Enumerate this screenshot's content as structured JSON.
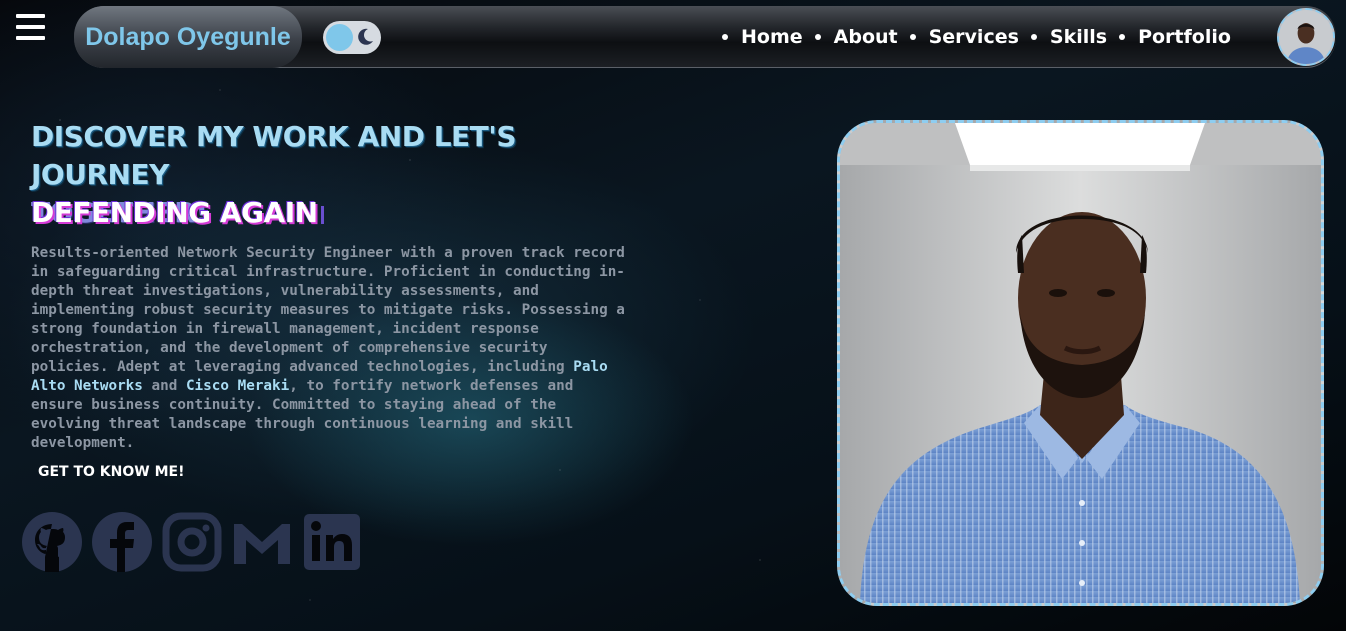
{
  "header": {
    "brand": "Dolapo Oyegunle",
    "nav": [
      {
        "label": "Home"
      },
      {
        "label": "About"
      },
      {
        "label": "Services"
      },
      {
        "label": "Skills"
      },
      {
        "label": "Portfolio"
      }
    ],
    "icons": {
      "menu": "hamburger-menu-icon",
      "theme": "moon-icon",
      "avatar": "profile-avatar"
    }
  },
  "hero": {
    "headline_line1": "Discover My Work and Let's Journey",
    "headline_line2": "Together!",
    "typed_text": "Defending Again",
    "bio": {
      "part1": "Results-oriented Network Security Engineer with a proven track record in safeguarding critical infrastructure. Proficient in conducting in-depth threat investigations, vulnerability assessments, and implementing robust security measures to mitigate risks. Possessing a strong foundation in firewall management, incident response orchestration, and the development of comprehensive security policies. Adept at leveraging advanced technologies, including ",
      "highlight1": "Palo Alto Networks",
      "part2": " and ",
      "highlight2": "Cisco Meraki",
      "part3": ", to fortify network defenses and ensure business continuity. Committed to staying ahead of the evolving threat landscape through continuous learning and skill development."
    },
    "cta_label": "Get to know me!",
    "socials": [
      {
        "icon": "github-icon"
      },
      {
        "icon": "facebook-icon"
      },
      {
        "icon": "instagram-icon"
      },
      {
        "icon": "gmail-icon"
      },
      {
        "icon": "linkedin-icon"
      }
    ]
  },
  "colors": {
    "accent": "#7fc7ea",
    "headline": "#a9dcf3",
    "headline_secondary": "#8188dc",
    "typed_shadow": "#d43bd6",
    "social_icons": "#2b3550"
  }
}
